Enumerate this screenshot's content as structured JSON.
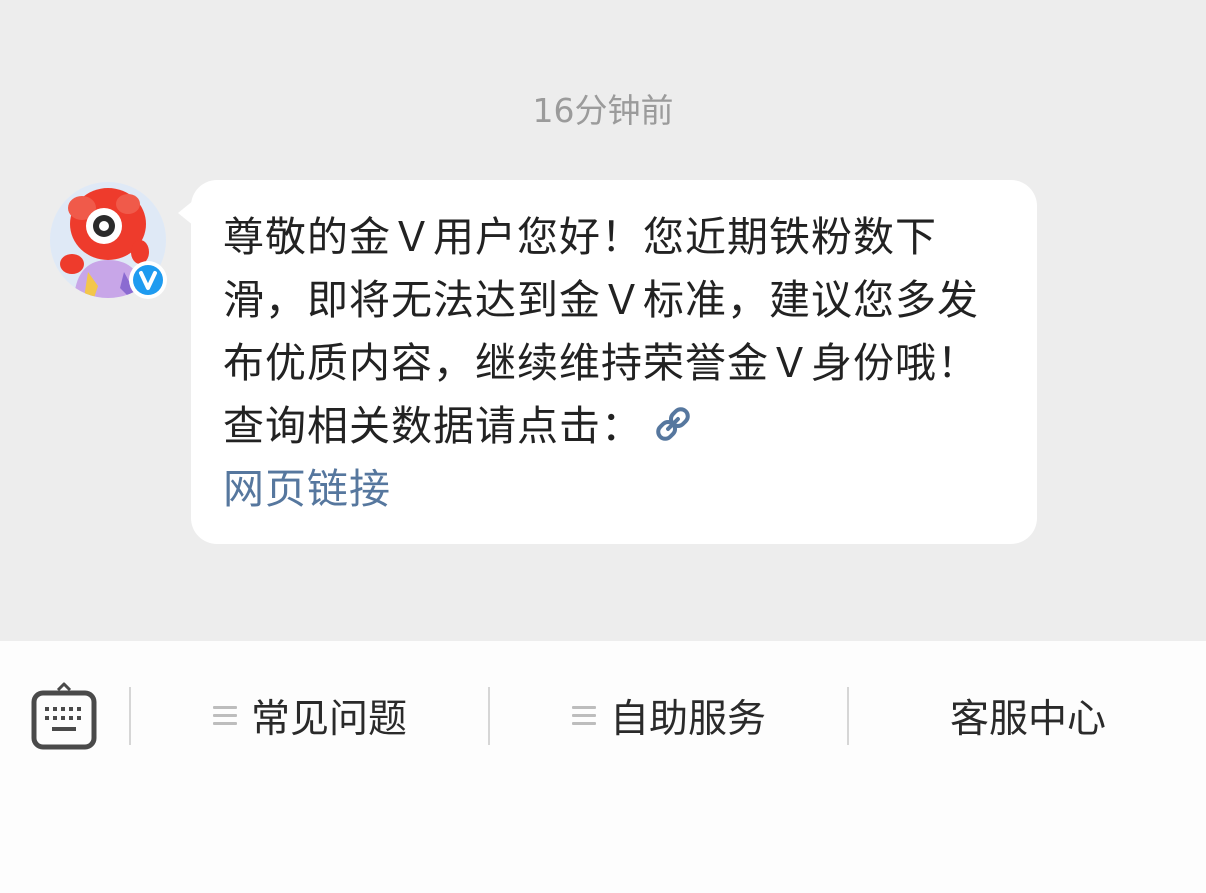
{
  "chat": {
    "timestamp": "16分钟前",
    "message": {
      "text": "尊敬的金Ｖ用户您好！您近期铁粉数下滑，即将无法达到金Ｖ标准，建议您多发布优质内容，继续维持荣誉金Ｖ身份哦！ 查询相关数据请点击：",
      "link_icon": "link-icon",
      "link_text": "网页链接"
    },
    "avatar": {
      "icon": "weibo-mascot-avatar",
      "badge": "V",
      "badge_color": "#1e9bf0"
    }
  },
  "bottom_bar": {
    "keyboard_icon": "keyboard-icon",
    "items": [
      {
        "label": "常见问题",
        "icon": "menu-icon"
      },
      {
        "label": "自助服务",
        "icon": "menu-icon"
      },
      {
        "label": "客服中心"
      }
    ]
  },
  "colors": {
    "chat_background": "#ededed",
    "bubble_background": "#ffffff",
    "link_color": "#56779e",
    "bottom_bar_background": "#fdfdfd"
  }
}
